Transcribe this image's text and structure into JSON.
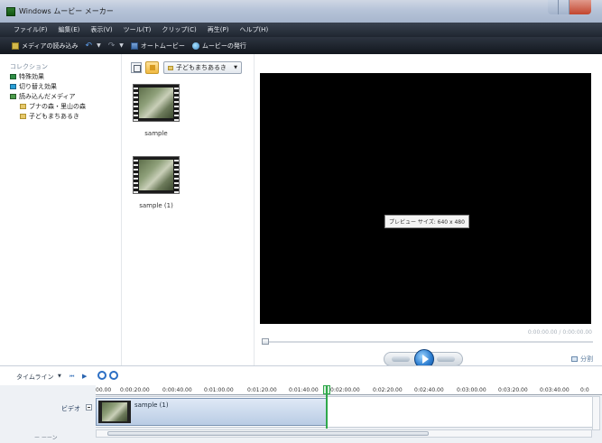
{
  "window": {
    "title": "Windows ムービー メーカー"
  },
  "menu": [
    "ファイル(F)",
    "編集(E)",
    "表示(V)",
    "ツール(T)",
    "クリップ(C)",
    "再生(P)",
    "ヘルプ(H)"
  ],
  "toolbar": {
    "import_label": "メディアの読み込み",
    "automovie_label": "オートムービー",
    "publish_label": "ムービーの発行"
  },
  "collections": {
    "heading": "コレクション",
    "items": [
      "特殊効果",
      "切り替え効果",
      "読み込んだメディア",
      "ブナの森・里山の森",
      "子どもまちあるき"
    ]
  },
  "content": {
    "folder_selected": "子どもまちあるき",
    "clips": [
      {
        "label": "sample"
      },
      {
        "label": "sample (1)"
      }
    ]
  },
  "preview": {
    "tooltip": "プレビュー サイズ: 640 x 480",
    "time_readout": "0:00:00.00 / 0:00:00.00",
    "split_label": "分割",
    "progress": 0.0
  },
  "timeline": {
    "label": "タイムライン",
    "ticks": [
      "00.00",
      "0:00:20.00",
      "0:00:40.00",
      "0:01:00.00",
      "0:01:20.00",
      "0:01:40.00",
      "0:02:00.00",
      "0:02:20.00",
      "0:02:40.00",
      "0:03:00.00",
      "0:03:20.00",
      "0:03:40.00",
      "0:0"
    ],
    "video_track_label": "ビデオ",
    "audio_track_label": "ー ーーン",
    "clip_name": "sample (1)"
  },
  "colors": {
    "menubar": "#2b323d",
    "toolbar": "#1f2630",
    "preview_bg": "#000000",
    "accent": "#2c6fc4",
    "playhead": "#2ea84a"
  },
  "icons": [
    "app-icon",
    "import-icon",
    "undo-icon",
    "redo-icon",
    "automovie-icon",
    "publish-icon",
    "view-icon",
    "up-folder-icon",
    "play-icon",
    "split-icon",
    "zoom-in-icon",
    "zoom-out-icon"
  ]
}
